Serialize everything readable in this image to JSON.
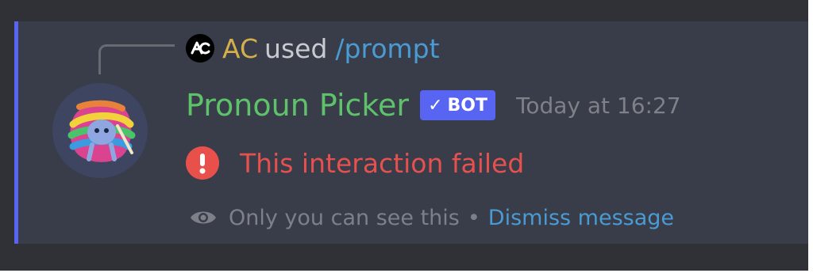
{
  "reply": {
    "username": "AC",
    "used_text": "used",
    "command": "/prompt"
  },
  "message": {
    "bot_name": "Pronoun Picker",
    "badge_check": "✓",
    "badge_label": "BOT",
    "timestamp": "Today at 16:27",
    "error_text": "This interaction failed"
  },
  "ephemeral": {
    "notice": "Only you can see this",
    "separator": "•",
    "dismiss_label": "Dismiss message"
  },
  "colors": {
    "accent_bar": "#5865f2",
    "bot_name": "#5ec26b",
    "reply_username": "#d5b04a",
    "command": "#4a9bd3",
    "error": "#e5514f",
    "badge": "#5865f2"
  },
  "icons": {
    "reply_avatar": "ac-logo-icon",
    "bot_avatar": "rainbow-bot-avatar",
    "error": "exclamation-circle-icon",
    "ephemeral": "eye-icon"
  }
}
